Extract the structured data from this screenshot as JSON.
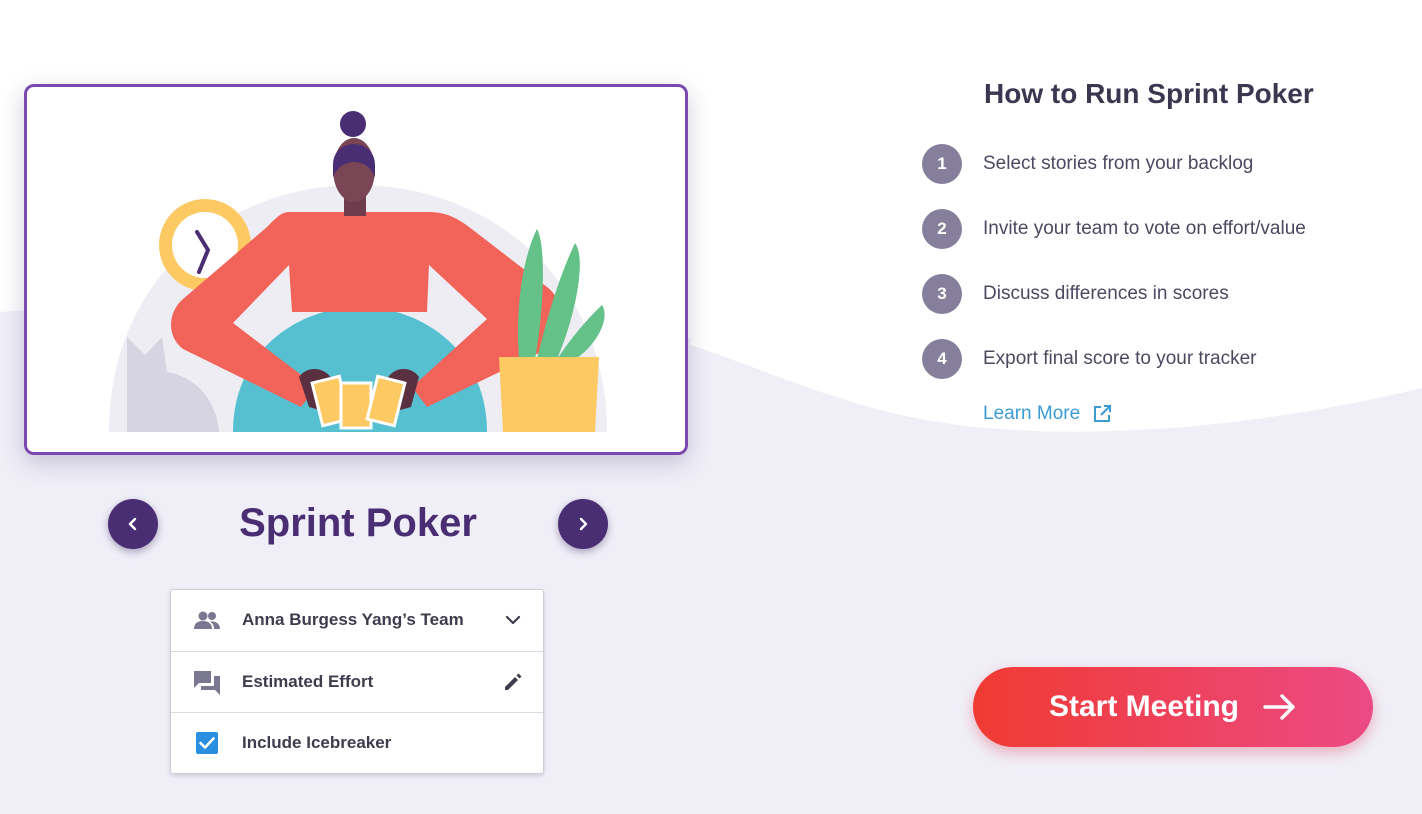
{
  "meeting": {
    "title": "Sprint Poker"
  },
  "options": {
    "team": "Anna Burgess Yang’s Team",
    "scale": "Estimated Effort",
    "icebreaker": "Include Icebreaker",
    "icebreaker_checked": true
  },
  "howto": {
    "title": "How to Run Sprint Poker",
    "steps": [
      {
        "num": "1",
        "text": "Select stories from your backlog"
      },
      {
        "num": "2",
        "text": "Invite your team to vote on effort/value"
      },
      {
        "num": "3",
        "text": "Discuss differences in scores"
      },
      {
        "num": "4",
        "text": "Export final score to your tracker"
      }
    ],
    "learn_more": "Learn More"
  },
  "start_button": {
    "label": "Start Meeting"
  },
  "colors": {
    "brand_purple": "#4a2e73",
    "card_border": "#7b48b0",
    "accent_blue": "#3d9bd3",
    "start_gradient_from": "#f03a32",
    "start_gradient_to": "#ec4a85",
    "background": "#f0eff8"
  },
  "icons": {
    "prev": "chevron-left-icon",
    "next": "chevron-right-icon",
    "team": "group-icon",
    "scale": "forum-icon",
    "dropdown": "chevron-down-icon",
    "edit": "pencil-icon",
    "checkbox": "checkbox-checked-icon",
    "external": "external-link-icon",
    "arrow": "arrow-right-icon"
  }
}
